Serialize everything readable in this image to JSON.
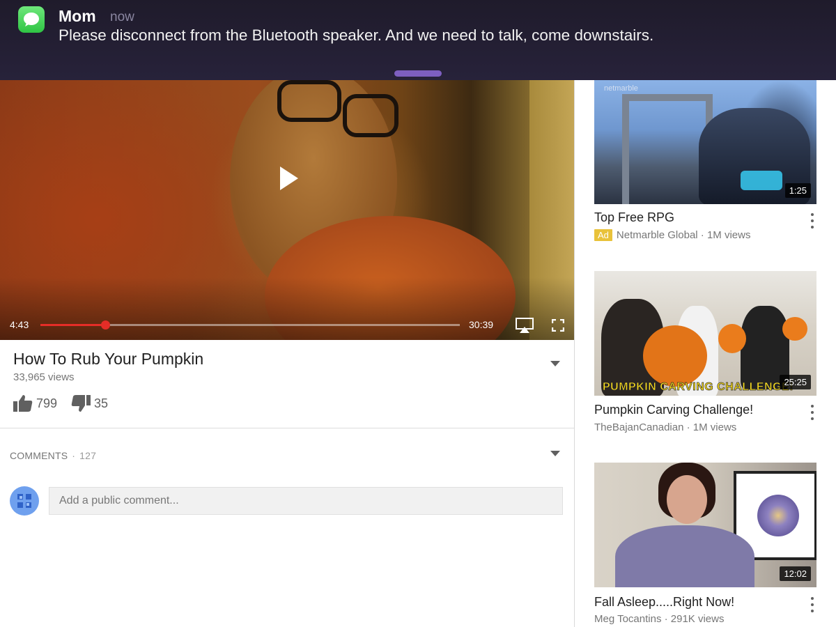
{
  "notification": {
    "sender": "Mom",
    "time": "now",
    "message": "Please disconnect from the Bluetooth speaker. And we need to talk, come downstairs.",
    "app_icon": "messages-icon",
    "accent_color": "#7d5fc0"
  },
  "player": {
    "current_time": "4:43",
    "total_time": "30:39",
    "progress_fraction": 0.154,
    "progress_color": "#e52d27"
  },
  "video": {
    "title": "How To Rub Your Pumpkin",
    "views": "33,965 views",
    "likes": "799",
    "dislikes": "35"
  },
  "comments": {
    "label": "COMMENTS",
    "separator": "·",
    "count": "127",
    "placeholder": "Add a public comment..."
  },
  "sidebar": {
    "videos": [
      {
        "title": "Top Free RPG",
        "ad_label": "Ad",
        "meta": "Netmarble Global · 1M views",
        "duration": "1:25",
        "thumb_text": "netmarble"
      },
      {
        "title": "Pumpkin Carving Challenge!",
        "meta": "TheBajanCanadian · 1M views",
        "duration": "25:25",
        "thumb_text": "PUMPKIN CARVING CHALLENGE!"
      },
      {
        "title": "Fall Asleep.....Right Now!",
        "meta": "Meg Tocantins · 291K views",
        "duration": "12:02"
      }
    ]
  }
}
